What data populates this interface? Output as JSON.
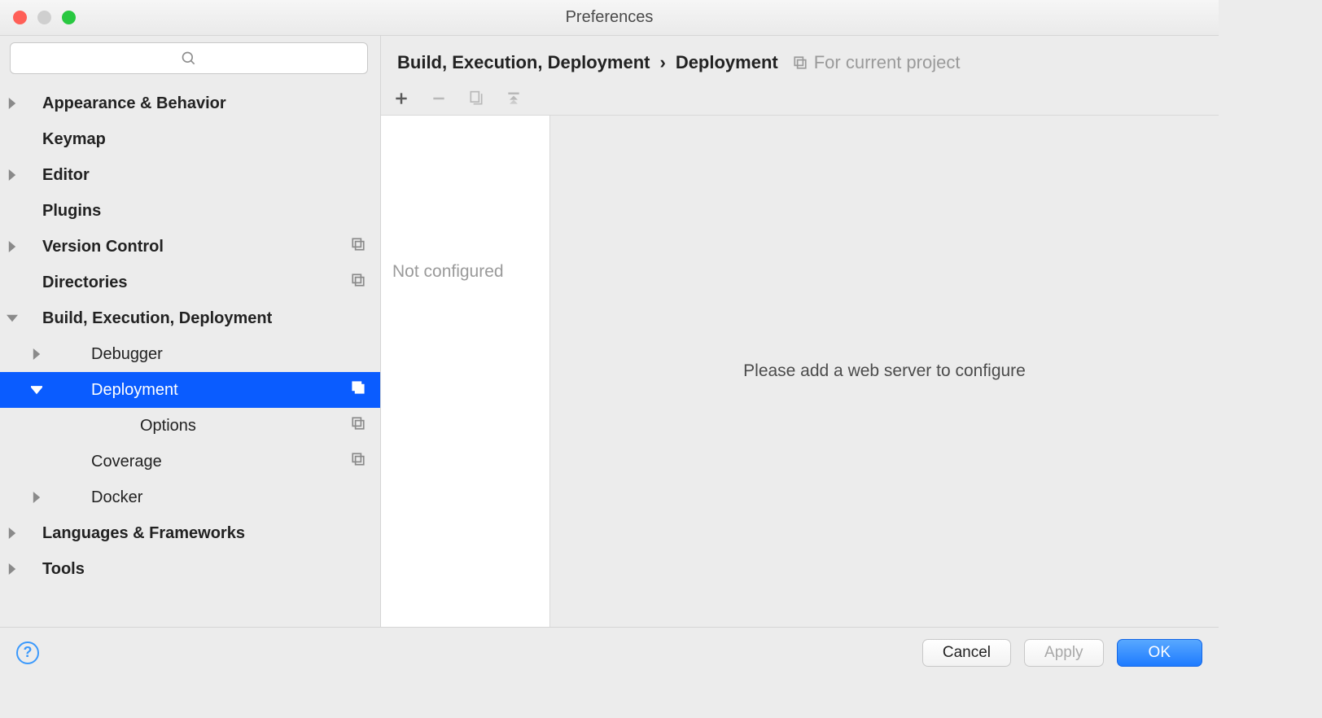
{
  "window": {
    "title": "Preferences"
  },
  "sidebar": {
    "search_placeholder": "",
    "items": [
      {
        "label": "Appearance & Behavior",
        "bold": true,
        "arrow": "right",
        "indent": 0,
        "proj": false
      },
      {
        "label": "Keymap",
        "bold": true,
        "arrow": "",
        "indent": 0,
        "proj": false
      },
      {
        "label": "Editor",
        "bold": true,
        "arrow": "right",
        "indent": 0,
        "proj": false
      },
      {
        "label": "Plugins",
        "bold": true,
        "arrow": "",
        "indent": 0,
        "proj": false
      },
      {
        "label": "Version Control",
        "bold": true,
        "arrow": "right",
        "indent": 0,
        "proj": true
      },
      {
        "label": "Directories",
        "bold": true,
        "arrow": "",
        "indent": 0,
        "proj": true
      },
      {
        "label": "Build, Execution, Deployment",
        "bold": true,
        "arrow": "down",
        "indent": 0,
        "proj": false
      },
      {
        "label": "Debugger",
        "bold": false,
        "arrow": "right",
        "indent": 1,
        "proj": false
      },
      {
        "label": "Deployment",
        "bold": false,
        "arrow": "down",
        "indent": 1,
        "proj": true,
        "selected": true
      },
      {
        "label": "Options",
        "bold": false,
        "arrow": "",
        "indent": 2,
        "proj": true
      },
      {
        "label": "Coverage",
        "bold": false,
        "arrow": "",
        "indent": 1,
        "proj": true
      },
      {
        "label": "Docker",
        "bold": false,
        "arrow": "right",
        "indent": 1,
        "proj": false
      },
      {
        "label": "Languages & Frameworks",
        "bold": true,
        "arrow": "right",
        "indent": 0,
        "proj": false
      },
      {
        "label": "Tools",
        "bold": true,
        "arrow": "right",
        "indent": 0,
        "proj": false
      }
    ]
  },
  "breadcrumb": {
    "part1": "Build, Execution, Deployment",
    "sep": "›",
    "part2": "Deployment",
    "scope": "For current project"
  },
  "toolbar": {
    "add_tip": "Add",
    "remove_tip": "Remove",
    "copy_tip": "Copy",
    "download_tip": "Download"
  },
  "listpane": {
    "empty_label": "Not configured"
  },
  "detail": {
    "empty_msg": "Please add a web server to configure"
  },
  "footer": {
    "cancel": "Cancel",
    "apply": "Apply",
    "ok": "OK"
  }
}
